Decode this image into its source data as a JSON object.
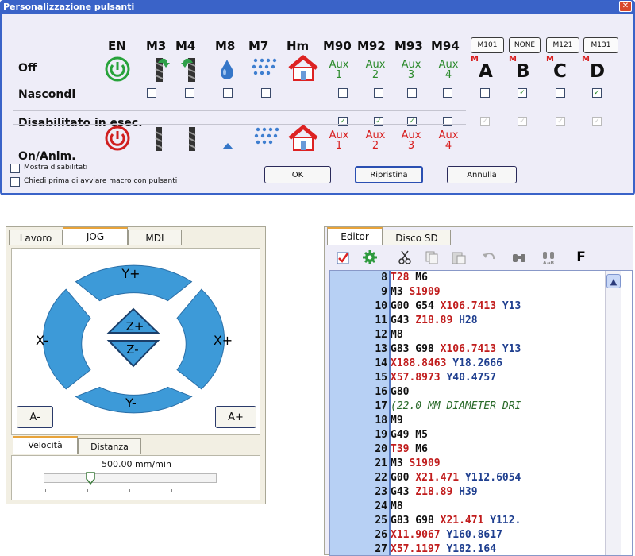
{
  "dialog": {
    "title": "Personalizzazione pulsanti",
    "close_glyph": "✕",
    "columns": [
      "EN",
      "M3",
      "M4",
      "M8",
      "M7",
      "Hm",
      "M90",
      "M92",
      "M93",
      "M94"
    ],
    "mcode_buttons": [
      "M101",
      "NONE",
      "M121",
      "M131"
    ],
    "rows": {
      "off": "Off",
      "hide": "Nascondi",
      "disabled_running": "Disabilitato in esec.",
      "on_anim": "On/Anim."
    },
    "aux_word": "Aux",
    "aux_numbers": [
      "1",
      "2",
      "3",
      "4"
    ],
    "m_superscript": "M",
    "macro_letters": [
      "A",
      "B",
      "C",
      "D"
    ],
    "hide_checked": [
      false,
      false,
      false,
      false,
      false,
      false,
      false,
      false,
      false,
      false,
      false,
      true,
      false,
      true
    ],
    "disabled_checked": [
      true,
      true,
      true,
      false,
      true,
      true,
      true,
      true
    ],
    "options": {
      "show_disabled": "Mostra disabilitati",
      "ask_before_macro": "Chiedi prima di avviare macro con pulsanti"
    },
    "buttons": {
      "ok": "OK",
      "restore": "Ripristina",
      "cancel": "Annulla"
    },
    "colors": {
      "title_bar": "#3a63c8",
      "body": "#eeedf8",
      "aux_green": "#2b8a2b",
      "aux_red": "#d81e1e"
    },
    "icons": [
      "power-on-icon",
      "spindle-cw-icon",
      "spindle-ccw-icon",
      "coolant-drop-icon",
      "mist-icon",
      "home-icon",
      "power-off-icon"
    ]
  },
  "jog": {
    "tabs": [
      "Lavoro",
      "JOG",
      "MDI"
    ],
    "active_tab": "JOG",
    "labels": {
      "y_plus": "Y+",
      "y_minus": "Y-",
      "x_minus": "X-",
      "x_plus": "X+",
      "z_plus": "Z+",
      "z_minus": "Z-"
    },
    "a_minus": "A-",
    "a_plus": "A+",
    "speed_tabs": [
      "Velocità",
      "Distanza"
    ],
    "speed_value": "500.00 mm/min",
    "slider_fraction": 0.27,
    "colors": {
      "jog_blue": "#3d9ad8"
    }
  },
  "editor": {
    "tabs": [
      "Editor",
      "Disco SD"
    ],
    "active_tab": "Editor",
    "toolbar_icons": [
      "check-icon",
      "settings-gear-icon",
      "cut-icon",
      "copy-icon",
      "paste-icon",
      "undo-icon",
      "find-icon",
      "replace-icon",
      "font-icon"
    ],
    "font_glyph": "F",
    "scroll_up_glyph": "▲",
    "lines": [
      {
        "n": "8",
        "tokens": [
          [
            "T28",
            "red"
          ],
          [
            " M6",
            "kw"
          ]
        ]
      },
      {
        "n": "9",
        "tokens": [
          [
            "M3",
            "kw"
          ],
          [
            " S1909",
            "red"
          ]
        ]
      },
      {
        "n": "10",
        "tokens": [
          [
            "G00 G54 ",
            "kw"
          ],
          [
            "X106.7413",
            "red"
          ],
          [
            " Y13",
            "blue"
          ]
        ]
      },
      {
        "n": "11",
        "tokens": [
          [
            "G43 ",
            "kw"
          ],
          [
            "Z18.89",
            "red"
          ],
          [
            " H28",
            "blue"
          ]
        ]
      },
      {
        "n": "12",
        "tokens": [
          [
            "M8",
            "kw"
          ]
        ]
      },
      {
        "n": "13",
        "tokens": [
          [
            "G83 G98 ",
            "kw"
          ],
          [
            "X106.7413",
            "red"
          ],
          [
            " Y13",
            "blue"
          ]
        ]
      },
      {
        "n": "14",
        "tokens": [
          [
            "X188.8463",
            "red"
          ],
          [
            " Y18.2666",
            "blue"
          ]
        ]
      },
      {
        "n": "15",
        "tokens": [
          [
            "X57.8973",
            "red"
          ],
          [
            " Y40.4757",
            "blue"
          ]
        ]
      },
      {
        "n": "16",
        "tokens": [
          [
            "G80",
            "kw"
          ]
        ]
      },
      {
        "n": "17",
        "tokens": [
          [
            "(22.0 MM DIAMETER DRI",
            "comment"
          ]
        ]
      },
      {
        "n": "18",
        "tokens": [
          [
            "M9",
            "kw"
          ]
        ]
      },
      {
        "n": "19",
        "tokens": [
          [
            "G49 M5",
            "kw"
          ]
        ]
      },
      {
        "n": "20",
        "tokens": [
          [
            "T39",
            "red"
          ],
          [
            " M6",
            "kw"
          ]
        ]
      },
      {
        "n": "21",
        "tokens": [
          [
            "M3",
            "kw"
          ],
          [
            " S1909",
            "red"
          ]
        ]
      },
      {
        "n": "22",
        "tokens": [
          [
            "G00 ",
            "kw"
          ],
          [
            "X21.471",
            "red"
          ],
          [
            " Y112.6054",
            "blue"
          ]
        ]
      },
      {
        "n": "23",
        "tokens": [
          [
            "G43 ",
            "kw"
          ],
          [
            "Z18.89",
            "red"
          ],
          [
            " H39",
            "blue"
          ]
        ]
      },
      {
        "n": "24",
        "tokens": [
          [
            "M8",
            "kw"
          ]
        ]
      },
      {
        "n": "25",
        "tokens": [
          [
            "G83 G98 ",
            "kw"
          ],
          [
            "X21.471",
            "red"
          ],
          [
            " Y112.",
            "blue"
          ]
        ]
      },
      {
        "n": "26",
        "tokens": [
          [
            "X11.9067",
            "red"
          ],
          [
            " Y160.8617",
            "blue"
          ]
        ]
      },
      {
        "n": "27",
        "tokens": [
          [
            "X57.1197",
            "red"
          ],
          [
            " Y182.164",
            "blue"
          ]
        ]
      }
    ]
  }
}
